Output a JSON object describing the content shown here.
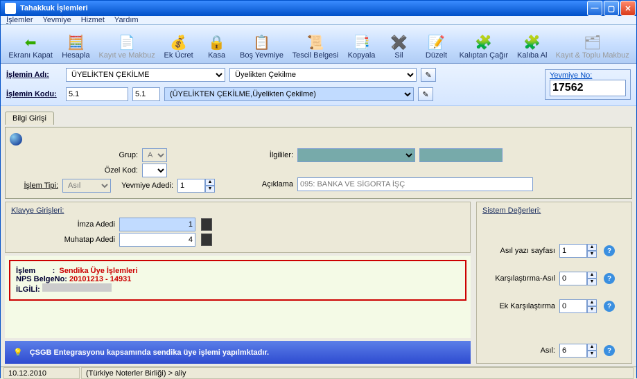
{
  "window": {
    "title": "Tahakkuk İşlemleri"
  },
  "menu": {
    "islemler": "İşlemler",
    "yevmiye": "Yevmiye",
    "hizmet": "Hizmet",
    "yardim": "Yardım"
  },
  "toolbar": {
    "ekrani_kapat": "Ekranı Kapat",
    "hesapla": "Hesapla",
    "kayit_makbuz": "Kayıt ve Makbuz",
    "ek_ucret": "Ek Ücret",
    "kasa": "Kasa",
    "bos_yevmiye": "Boş Yevmiye",
    "tescil_belgesi": "Tescil Belgesi",
    "kopyala": "Kopyala",
    "sil": "Sil",
    "duzelt": "Düzelt",
    "kaliptan_cagir": "Kalıptan Çağır",
    "kaliba_al": "Kalıba Al",
    "kayit_toplu": "Kayıt & Toplu Makbuz"
  },
  "form": {
    "islemin_adi_lbl": "İşlemin Adı:",
    "islemin_adi_val": "ÜYELİKTEN ÇEKİLME",
    "islemin_adi_sub": "Üyelikten Çekilme",
    "islemin_kodu_lbl": "İşlemin Kodu:",
    "islemin_kodu_val": "5.1",
    "islemin_kodu_val2": "5.1",
    "islemin_kodu_desc": "(ÜYELİKTEN ÇEKİLME,Üyelikten Çekilme)",
    "yevmiye_lbl": "Yevmiye No:",
    "yevmiye_val": "17562"
  },
  "tab": {
    "bilgi": "Bilgi Girişi"
  },
  "panel": {
    "grup_lbl": "Grup:",
    "grup_val": "A",
    "ozel_kod_lbl": "Özel Kod:",
    "islem_tipi_lbl": "İşlem Tipi:",
    "islem_tipi_val": "Asıl",
    "yevmiye_adedi_lbl": "Yevmiye Adedi:",
    "yevmiye_adedi_val": "1",
    "ilgililer_lbl": "İlgililer:",
    "aciklama_lbl": "Açıklama",
    "aciklama_val": "095: BANKA VE SİGORTA İŞÇ"
  },
  "klavye": {
    "legend": "Klavye Girişleri:",
    "imza_lbl": "İmza Adedi",
    "imza_val": "1",
    "muhatap_lbl": "Muhatap Adedi",
    "muhatap_val": "4"
  },
  "sistem": {
    "legend": "Sistem Değerleri:",
    "asil_yazi_lbl": "Asıl yazı sayfası",
    "asil_yazi_val": "1",
    "kars_asil_lbl": "Karşılaştırma-Asıl",
    "kars_asil_val": "0",
    "ek_kars_lbl": "Ek Karşılaştırma",
    "ek_kars_val": "0",
    "asil_lbl": "Asıl:",
    "asil_val": "6"
  },
  "info": {
    "islem_k": "İşlem",
    "sep": ":",
    "islem_v": "Sendika Üye İşlemleri",
    "nps_k": "NPS BelgeNo:",
    "nps_v": "20101213 - 14931",
    "ilgili_k": "İLGİLİ:"
  },
  "banner": "ÇSGB Entegrasyonu kapsamında sendika üye işlemi yapılmktadır.",
  "status": {
    "date": "10.12.2010",
    "path": "(Türkiye Noterler Birliği) > aliy"
  }
}
